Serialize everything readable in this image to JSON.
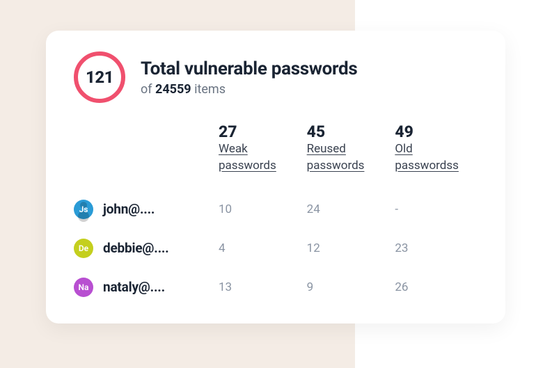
{
  "summary": {
    "total": "121",
    "title": "Total vulnerable passwords",
    "subtitle_prefix": "of ",
    "subtitle_count": "24559",
    "subtitle_suffix": " items"
  },
  "columns": [
    {
      "count": "27",
      "label": "Weak passwords"
    },
    {
      "count": "45",
      "label": "Reused passwords"
    },
    {
      "count": "49",
      "label": "Old passwordss"
    }
  ],
  "users": [
    {
      "initials": "Js",
      "email": "john@....",
      "color": "#2a9bd6",
      "person_silhouette": true,
      "values": [
        "10",
        "24",
        "-"
      ]
    },
    {
      "initials": "De",
      "email": "debbie@....",
      "color": "#c4cf1e",
      "person_silhouette": false,
      "values": [
        "4",
        "12",
        "23"
      ]
    },
    {
      "initials": "Na",
      "email": "nataly@....",
      "color": "#b84fd1",
      "person_silhouette": false,
      "values": [
        "13",
        "9",
        "26"
      ]
    }
  ]
}
